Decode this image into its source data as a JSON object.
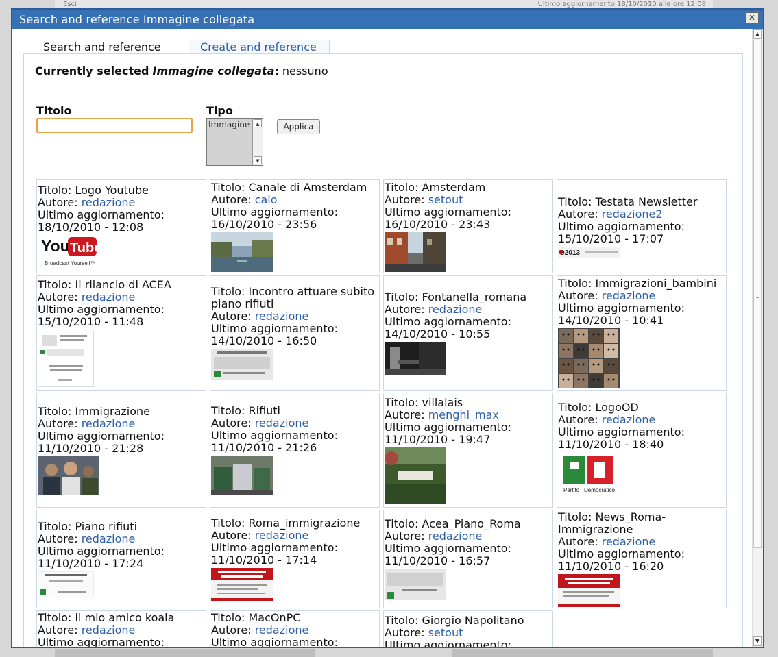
{
  "background": {
    "left_text": "Esci",
    "right_text": "Ultimo aggiornamento 18/10/2010 alle ore 12:08"
  },
  "dialog": {
    "title": "Search and reference Immagine collegata",
    "close_label": "✕"
  },
  "tabs": [
    {
      "label": "Search and reference",
      "active": true
    },
    {
      "label": "Create and reference",
      "active": false
    }
  ],
  "current": {
    "prefix": "Currently selected",
    "type": "Immagine collegata",
    "colon": ":",
    "value": "nessuno"
  },
  "filters": {
    "titolo_label": "Titolo",
    "titolo_value": "",
    "tipo_label": "Tipo",
    "tipo_option": "Immagine",
    "apply_label": "Applica"
  },
  "labels": {
    "titolo": "Titolo:",
    "autore": "Autore:",
    "updated": "Ultimo aggiornamento:"
  },
  "items": [
    {
      "title": "Logo Youtube",
      "author": "redazione",
      "date": "18/10/2010 - 12:08",
      "thumb": "youtube-logo"
    },
    {
      "title": "Canale di Amsterdam",
      "author": "caio",
      "date": "16/10/2010 - 23:56",
      "thumb": "canal-photo"
    },
    {
      "title": "Amsterdam",
      "author": "setout",
      "date": "16/10/2010 - 23:43",
      "thumb": "street-photo"
    },
    {
      "title": "Testata Newsletter",
      "author": "redazione2",
      "date": "15/10/2010 - 17:07",
      "thumb": "newsletter-banner"
    },
    {
      "title": "Il rilancio di ACEA",
      "author": "redazione",
      "date": "15/10/2010 - 11:48",
      "thumb": "document-page"
    },
    {
      "title": "Incontro attuare subito piano rifiuti",
      "author": "redazione",
      "date": "14/10/2010 - 16:50",
      "thumb": "flyer-grey"
    },
    {
      "title": "Fontanella_romana",
      "author": "redazione",
      "date": "14/10/2010 - 10:55",
      "thumb": "fountain-photo"
    },
    {
      "title": "Immigrazioni_bambini",
      "author": "redazione",
      "date": "14/10/2010 - 10:41",
      "thumb": "faces-collage"
    },
    {
      "title": "Immigrazione",
      "author": "redazione",
      "date": "11/10/2010 - 21:28",
      "thumb": "crowd-photo"
    },
    {
      "title": "Rifiuti",
      "author": "redazione",
      "date": "11/10/2010 - 21:26",
      "thumb": "bins-photo"
    },
    {
      "title": "villalais",
      "author": "menghi_max",
      "date": "11/10/2010 - 19:47",
      "thumb": "garden-photo"
    },
    {
      "title": "LogoOD",
      "author": "redazione",
      "date": "11/10/2010 - 18:40",
      "thumb": "pd-logo"
    },
    {
      "title": "Piano rifiuti",
      "author": "redazione",
      "date": "11/10/2010 - 17:24",
      "thumb": "flyer-white"
    },
    {
      "title": "Roma_immigrazione",
      "author": "redazione",
      "date": "11/10/2010 - 17:14",
      "thumb": "red-poster"
    },
    {
      "title": "Acea_Piano_Roma",
      "author": "redazione",
      "date": "11/10/2010 - 16:57",
      "thumb": "flyer-grey2"
    },
    {
      "title": "News_Roma-Immigrazione",
      "author": "redazione",
      "date": "11/10/2010 - 16:20",
      "thumb": "red-poster2"
    },
    {
      "title": "il mio amico koala",
      "author": "redazione",
      "date": "",
      "thumb": ""
    },
    {
      "title": "MacOnPC",
      "author": "redazione",
      "date": "",
      "thumb": ""
    },
    {
      "title": "Giorgio Napolitano",
      "author": "setout",
      "date": "",
      "thumb": ""
    }
  ],
  "thumb_texts": {
    "youtube_you": "You",
    "youtube_tube": "Tube",
    "youtube_tag": "Broadcast Yourself™",
    "newsletter": "O2013",
    "pd_party": "Partito",
    "pd_dem": "Democratico"
  },
  "colors": {
    "titlebar": "#3670b5",
    "link": "#2d5fa8",
    "border": "#c9d9e9",
    "focus": "#e8a34a"
  }
}
